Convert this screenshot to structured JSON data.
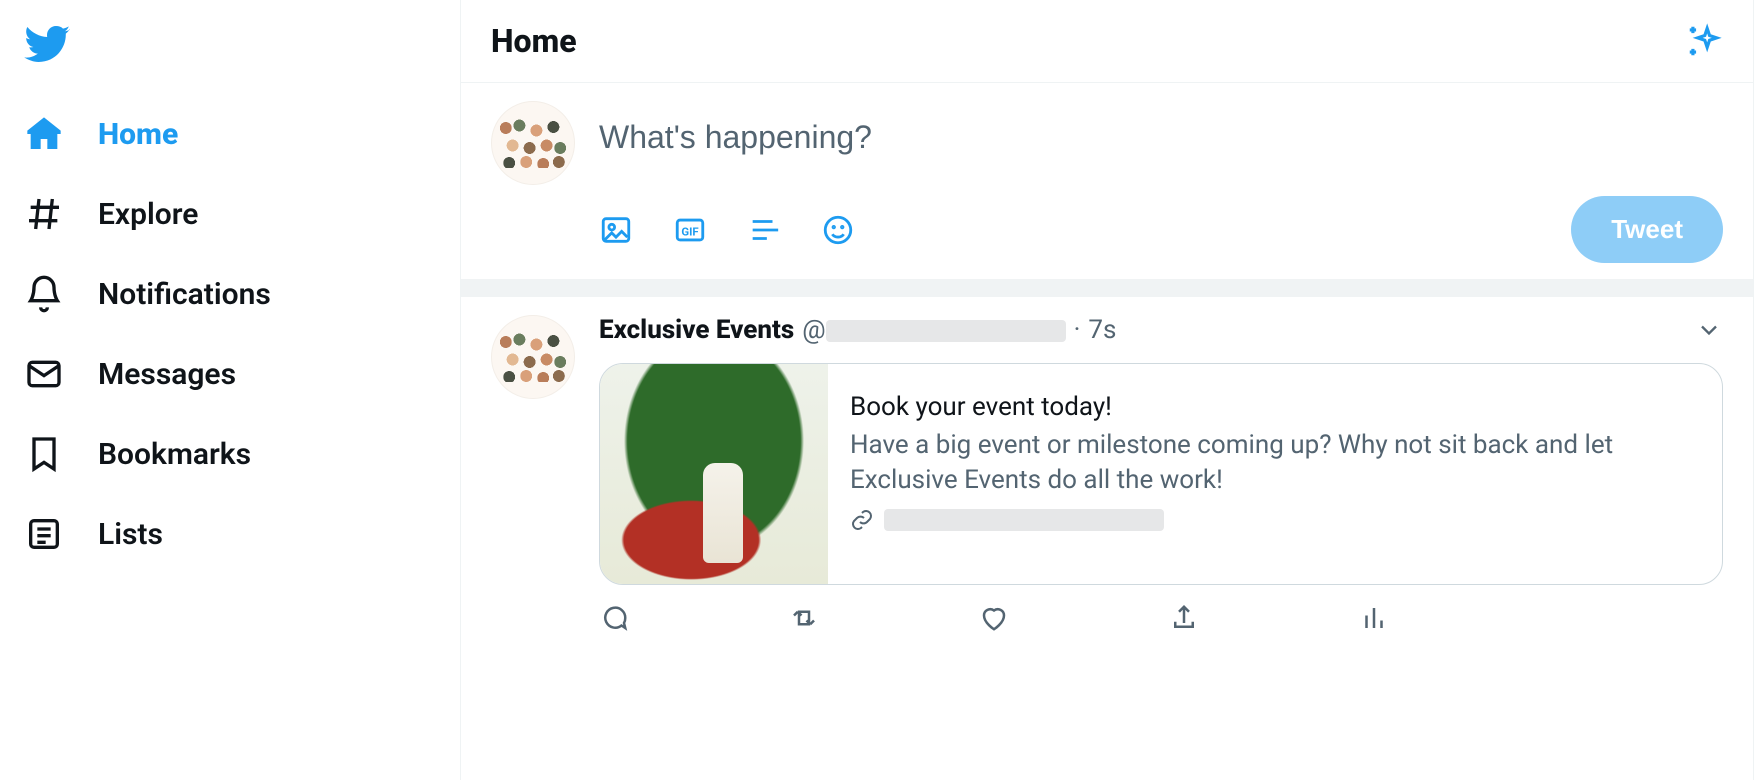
{
  "colors": {
    "accent": "#1d9bf0",
    "text": "#0f1419",
    "muted": "#536471"
  },
  "header": {
    "title": "Home"
  },
  "sidebar": {
    "items": [
      {
        "label": "Home",
        "icon": "home-icon",
        "active": true
      },
      {
        "label": "Explore",
        "icon": "hashtag-icon",
        "active": false
      },
      {
        "label": "Notifications",
        "icon": "bell-icon",
        "active": false
      },
      {
        "label": "Messages",
        "icon": "envelope-icon",
        "active": false
      },
      {
        "label": "Bookmarks",
        "icon": "bookmark-icon",
        "active": false
      },
      {
        "label": "Lists",
        "icon": "list-icon",
        "active": false
      }
    ]
  },
  "composer": {
    "placeholder": "What's happening?",
    "tweet_button": "Tweet"
  },
  "feed": {
    "tweets": [
      {
        "author_name": "Exclusive Events",
        "author_handle_prefix": "@",
        "author_handle_redacted": true,
        "time_separator": "·",
        "time": "7s",
        "card": {
          "title": "Book your event today!",
          "description": "Have a big event or milestone coming up? Why not sit back and let Exclusive Events do all the work!",
          "link_redacted": true
        }
      }
    ]
  }
}
